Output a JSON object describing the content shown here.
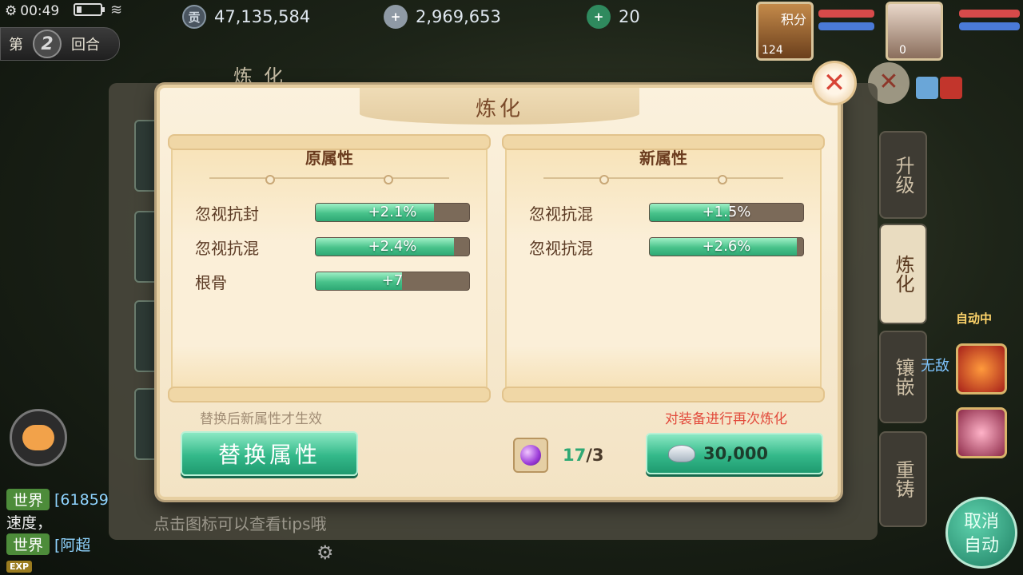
{
  "status": {
    "time": "00:49"
  },
  "currencies": [
    {
      "icon": "contribution-icon",
      "value": "47,135,584"
    },
    {
      "icon": "silver-coin-icon",
      "value": "2,969,653"
    },
    {
      "icon": "jade-coin-icon",
      "value": "20"
    }
  ],
  "round": {
    "prefix": "第",
    "number": "2",
    "suffix": "回合"
  },
  "portraits": [
    {
      "label": "积分",
      "level": "124"
    },
    {
      "label": "",
      "level": "0"
    }
  ],
  "background": {
    "title": "炼化",
    "tabs": [
      {
        "label": "升级",
        "active": false
      },
      {
        "label": "炼化",
        "active": true
      },
      {
        "label": "镶嵌",
        "active": false
      },
      {
        "label": "重铸",
        "active": false
      }
    ],
    "auto_label": "自动中",
    "wudi": "无敌",
    "cancel_auto": "取消自动",
    "tips": "点击图标可以查看tips哦",
    "exp": "EXP"
  },
  "chat": [
    {
      "channel": "世界",
      "text": "[61859"
    },
    {
      "channel": "",
      "text": "速度，"
    },
    {
      "channel": "世界",
      "text": "[阿超"
    }
  ],
  "dialog": {
    "title": "炼化",
    "old_panel": {
      "header": "原属性",
      "attrs": [
        {
          "name": "忽视抗封",
          "value": "+2.1%",
          "fill": 0.77
        },
        {
          "name": "忽视抗混",
          "value": "+2.4%",
          "fill": 0.9
        },
        {
          "name": "根骨",
          "value": "+7",
          "fill": 0.56
        }
      ]
    },
    "new_panel": {
      "header": "新属性",
      "attrs": [
        {
          "name": "忽视抗混",
          "value": "+1.5%",
          "fill": 0.52
        },
        {
          "name": "忽视抗混",
          "value": "+2.6%",
          "fill": 0.96
        }
      ]
    },
    "hint_left": "替换后新属性才生效",
    "hint_right": "对装备进行再次炼化",
    "replace_button": "替换属性",
    "material": {
      "owned": "17",
      "need": "/3"
    },
    "refine_cost": "30,000"
  },
  "colors": {
    "accent_green": "#34b98a",
    "hint_left": "#a08c74",
    "hint_right": "#e24a3b",
    "title_brown": "#7a4a2a"
  }
}
